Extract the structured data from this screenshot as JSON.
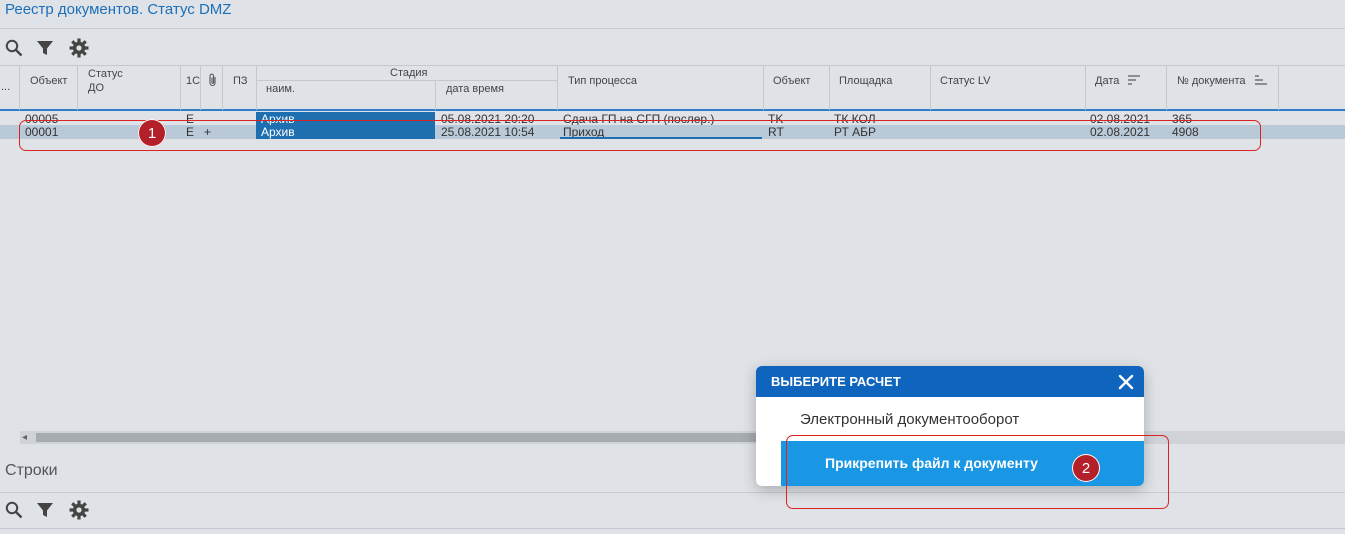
{
  "window": {
    "title": "Реестр документов. Статус DMZ"
  },
  "toolbar": {
    "icons": [
      "search-icon",
      "filter-icon",
      "settings-icon"
    ]
  },
  "grid": {
    "headers": {
      "more": "...",
      "object": "Объект",
      "status_do_1": "Статус",
      "status_do_2": "ДО",
      "col_1c": "1С",
      "col_attach": "",
      "col_pz": "ПЗ",
      "stage": "Стадия",
      "stage_name": "наим.",
      "stage_datetime": "дата время",
      "process_type": "Тип процесса",
      "object2": "Объект",
      "site": "Площадка",
      "status_lv": "Статус LV",
      "date": "Дата",
      "doc_number": "№ документа"
    },
    "rows": [
      {
        "object": "00005",
        "col_1c": "E",
        "plus": "",
        "stage_name": "Архив",
        "stage_datetime": "05.08.2021 20:20",
        "process_type": "Сдача ГП на СГП (послер.)",
        "object2": "TK",
        "site": "ТК КОЛ",
        "date": "02.08.2021",
        "doc_number": "365"
      },
      {
        "object": "00001",
        "col_1c": "E",
        "plus": "+",
        "stage_name": "Архив",
        "stage_datetime": "25.08.2021 10:54",
        "process_type": "Приход",
        "object2": "RT",
        "site": "РТ АБР",
        "date": "02.08.2021",
        "doc_number": "4908"
      }
    ]
  },
  "lines_section": {
    "title": "Строки"
  },
  "popup": {
    "title": "ВЫБЕРИТЕ РАСЧЕТ",
    "items": [
      "Электронный документооборот",
      "Прикрепить файл к документу"
    ]
  },
  "annotations": {
    "badge1": "1",
    "badge2": "2"
  },
  "colors": {
    "accent": "#0f65bd",
    "highlight": "#1996e4",
    "callout": "#dd2222",
    "badge": "#b4202a"
  }
}
